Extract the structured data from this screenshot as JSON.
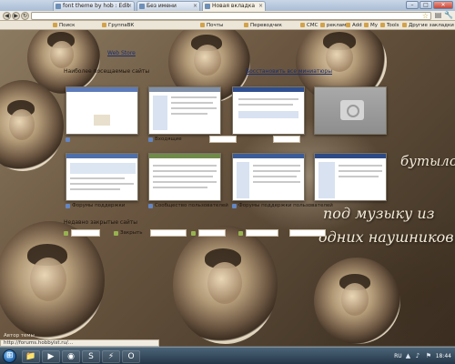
{
  "window": {
    "tabs": [
      {
        "label": "font theme by hob : Edit"
      },
      {
        "label": "Без имени"
      },
      {
        "label": "Новая вкладка"
      }
    ],
    "minimize": "–",
    "maximize": "□",
    "close": "✕"
  },
  "toolbar": {
    "back": "◀",
    "forward": "▶",
    "reload": "↻",
    "star": "☆",
    "page_menu": "▤",
    "tools_menu": "🔧"
  },
  "bookmarks": [
    {
      "label": "Поиск"
    },
    {
      "label": "ГруппаВК"
    },
    {
      "label": "Почты"
    },
    {
      "label": "Переводчик"
    },
    {
      "label": "СМС"
    },
    {
      "label": "реклама"
    },
    {
      "label": "Add"
    },
    {
      "label": "My"
    },
    {
      "label": "Tools"
    },
    {
      "label": "Другие закладки"
    }
  ],
  "newtab": {
    "web_store_link": "Web Store",
    "most_visited_title": "Наиболее посещаемые сайты",
    "restore_all_link": "Восстановить все миниатюры",
    "thumbnails_row1": [
      {
        "caption": ""
      },
      {
        "caption": "Входящие"
      },
      {
        "caption": ""
      },
      {
        "caption": ""
      }
    ],
    "thumbnails_row2": [
      {
        "caption": "Форумы поддержки"
      },
      {
        "caption": "Сообщество пользователей"
      },
      {
        "caption": "Форумы поддержки пользователей"
      },
      {
        "caption": ""
      }
    ],
    "recently_closed_title": "Недавно закрытые сайты",
    "recently_closed": [
      {
        "label": ""
      },
      {
        "label": "Закрыть"
      },
      {
        "label": ""
      },
      {
        "label": ""
      }
    ]
  },
  "wallpaper_text": {
    "line1": "бутылок",
    "line2": "под музыку из",
    "line3": "одних наушников..."
  },
  "status": {
    "left_text": "Автор темы",
    "url_text": "http://forums.hobbyist.ru/..."
  },
  "taskbar": {
    "start_label": "Пуск",
    "pinned": [
      {
        "icon": "explorer-icon",
        "glyph": "📁"
      },
      {
        "icon": "media-player-icon",
        "glyph": "▶"
      },
      {
        "icon": "chrome-icon",
        "glyph": "◉"
      },
      {
        "icon": "skype-icon",
        "glyph": "S"
      },
      {
        "icon": "flash-icon",
        "glyph": "⚡"
      },
      {
        "icon": "opera-icon",
        "glyph": "O"
      }
    ],
    "language": "RU",
    "clock": "18:44"
  }
}
